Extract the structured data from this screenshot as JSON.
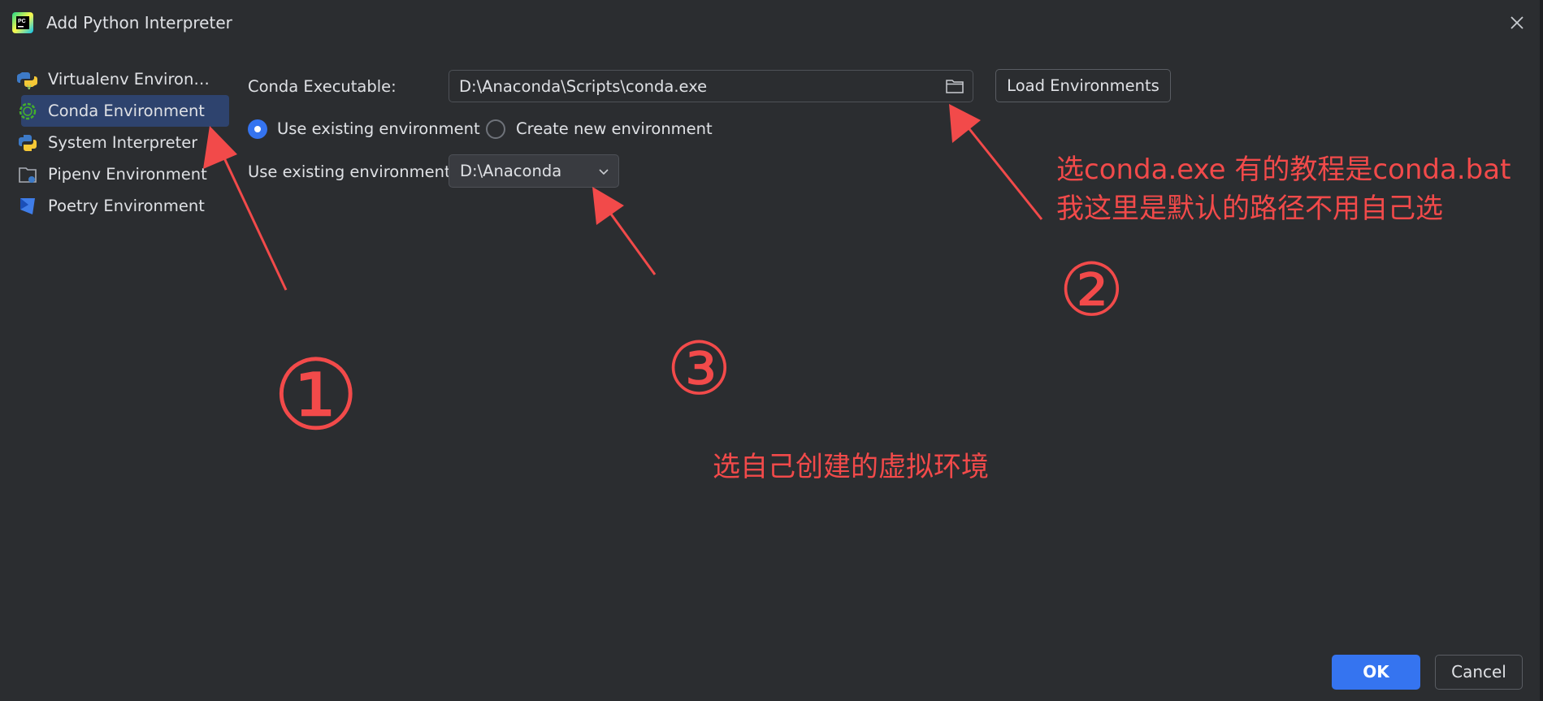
{
  "window": {
    "title": "Add Python Interpreter",
    "app_icon": "pycharm-icon",
    "close_icon": "close-icon"
  },
  "sidebar": {
    "items": [
      {
        "label": "Virtualenv Environme...",
        "icon": "virtualenv-icon",
        "selected": false
      },
      {
        "label": "Conda Environment",
        "icon": "conda-icon",
        "selected": true
      },
      {
        "label": "System Interpreter",
        "icon": "python-icon",
        "selected": false
      },
      {
        "label": "Pipenv Environment",
        "icon": "pipenv-icon",
        "selected": false
      },
      {
        "label": "Poetry Environment",
        "icon": "poetry-icon",
        "selected": false
      }
    ]
  },
  "form": {
    "conda_executable_label": "Conda Executable:",
    "conda_executable_value": "D:\\Anaconda\\Scripts\\conda.exe",
    "load_button": "Load Environments",
    "radio_existing": "Use existing environment",
    "radio_new": "Create new environment",
    "existing_env_label": "Use existing environment:",
    "existing_env_value": "D:\\Anaconda"
  },
  "annotations": {
    "num1": "①",
    "num2": "②",
    "num3": "③",
    "note2_line1": "选conda.exe 有的教程是conda.bat",
    "note2_line2": "我这里是默认的路径不用自己选",
    "note3": "选自己创建的虚拟环境",
    "color": "#f24a4a"
  },
  "footer": {
    "ok": "OK",
    "cancel": "Cancel"
  },
  "colors": {
    "background": "#2b2d30",
    "accent": "#3574f0",
    "selection": "#2e436e"
  }
}
